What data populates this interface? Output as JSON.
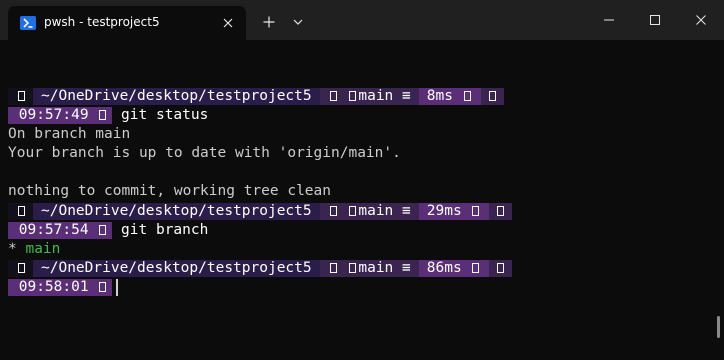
{
  "window": {
    "tab_title": "pwsh - testproject5",
    "icons": {
      "tab": "powershell-icon",
      "close_tab": "close-icon",
      "new_tab": "plus-icon",
      "dropdown": "chevron-down-icon",
      "minimize": "minimize-icon",
      "maximize": "maximize-icon",
      "close_window": "close-icon"
    }
  },
  "prompts": [
    {
      "path": "~/OneDrive/desktop/testproject5",
      "branch": "main",
      "status": "≡",
      "duration": "8ms",
      "time": "09:57:49",
      "command": "git status"
    },
    {
      "path": "~/OneDrive/desktop/testproject5",
      "branch": "main",
      "status": "≡",
      "duration": "29ms",
      "time": "09:57:54",
      "command": "git branch"
    },
    {
      "path": "~/OneDrive/desktop/testproject5",
      "branch": "main",
      "status": "≡",
      "duration": "86ms",
      "time": "09:58:01",
      "command": ""
    }
  ],
  "output": {
    "status_line1": "On branch main",
    "status_line2": "Your branch is up to date with 'origin/main'.",
    "status_line3": "nothing to commit, working tree clean",
    "branch_marker": "*",
    "branch_name": "main"
  },
  "colors": {
    "background": "#0c0c0c",
    "titlebar": "#202020",
    "prompt_path_bg": "#2a1d4a",
    "prompt_time_bg": "#5a2f78",
    "current_branch": "#3fb94f"
  }
}
